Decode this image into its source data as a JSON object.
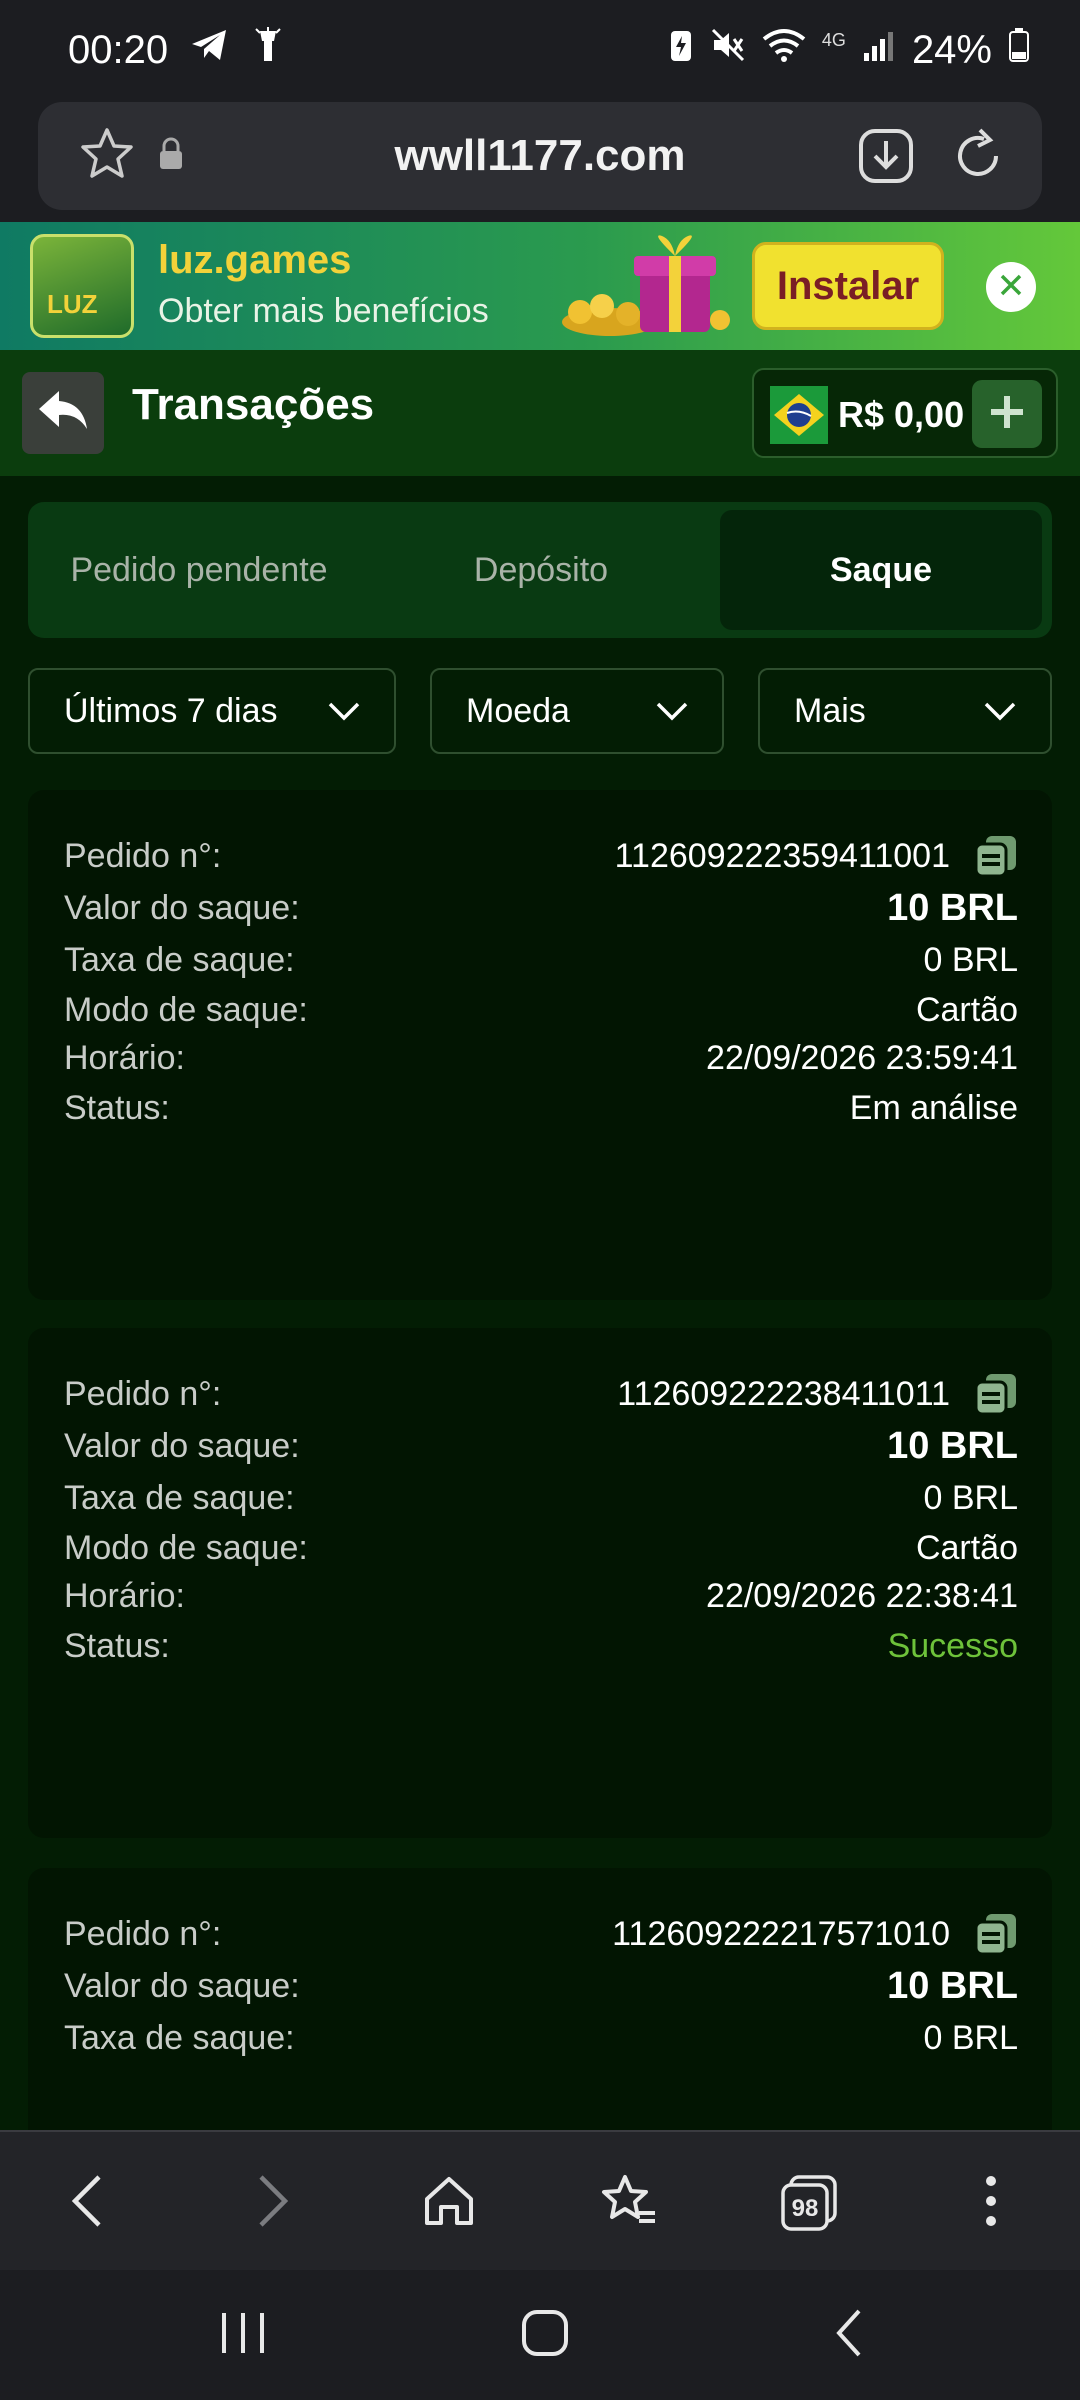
{
  "status_bar": {
    "time": "00:20",
    "network": "4G",
    "battery": "24%"
  },
  "browser": {
    "url": "wwll1177.com"
  },
  "banner": {
    "icon_text": "LUZ",
    "title": "luz.games",
    "subtitle": "Obter mais benefícios",
    "install_label": "Instalar"
  },
  "header": {
    "title": "Transações",
    "balance": "R$ 0,00"
  },
  "tabs": [
    {
      "label": "Pedido pendente",
      "active": false
    },
    {
      "label": "Depósito",
      "active": false
    },
    {
      "label": "Saque",
      "active": true
    }
  ],
  "filters": {
    "period": "Últimos 7 dias",
    "currency": "Moeda",
    "more": "Mais"
  },
  "labels": {
    "order": "Pedido n°:",
    "amount": "Valor do saque:",
    "fee": "Taxa de saque:",
    "mode": "Modo de saque:",
    "time": "Horário:",
    "status": "Status:"
  },
  "transactions": [
    {
      "order": "112609222359411001",
      "amount": "10 BRL",
      "fee": "0 BRL",
      "mode": "Cartão",
      "time": "22/09/2026 23:59:41",
      "status": "Em análise"
    },
    {
      "order": "112609222238411011",
      "amount": "10 BRL",
      "fee": "0 BRL",
      "mode": "Cartão",
      "time": "22/09/2026 22:38:41",
      "status": "Sucesso"
    },
    {
      "order": "112609222217571010",
      "amount": "10 BRL",
      "fee": "0 BRL"
    }
  ],
  "browser_nav": {
    "tabs_count": "98"
  },
  "colors": {
    "success": "#6ec23a",
    "header_bg": "#0b3d0d",
    "content_bg": "#031d04",
    "install_bg": "#f1e12f"
  }
}
